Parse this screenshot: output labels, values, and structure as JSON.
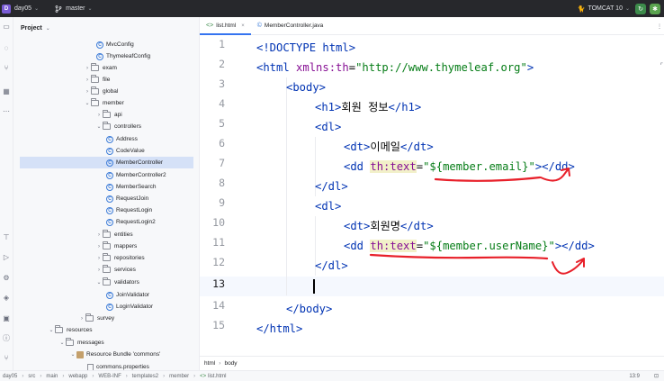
{
  "titlebar": {
    "project_badge": "D",
    "project_name": "day05",
    "branch": "master",
    "run_config": "TOMCAT 10",
    "colors": {
      "background": "#27282c",
      "badge": "#7a5cd6",
      "run": "#3d8b4b"
    }
  },
  "project_panel": {
    "title": "Project",
    "tree": [
      {
        "label": "MvcConfig",
        "kind": "class"
      },
      {
        "label": "ThymeleafConfig",
        "kind": "class"
      },
      {
        "label": "exam",
        "kind": "folder"
      },
      {
        "label": "file",
        "kind": "folder"
      },
      {
        "label": "global",
        "kind": "folder"
      },
      {
        "label": "member",
        "kind": "folder"
      },
      {
        "label": "api",
        "kind": "folder"
      },
      {
        "label": "controllers",
        "kind": "folder"
      },
      {
        "label": "Address",
        "kind": "class"
      },
      {
        "label": "CodeValue",
        "kind": "class"
      },
      {
        "label": "MemberController",
        "kind": "class",
        "selected": true
      },
      {
        "label": "MemberController2",
        "kind": "class"
      },
      {
        "label": "MemberSearch",
        "kind": "class"
      },
      {
        "label": "RequestJoin",
        "kind": "class"
      },
      {
        "label": "RequestLogin",
        "kind": "class"
      },
      {
        "label": "RequestLogin2",
        "kind": "class"
      },
      {
        "label": "entities",
        "kind": "folder"
      },
      {
        "label": "mappers",
        "kind": "folder"
      },
      {
        "label": "repositories",
        "kind": "folder"
      },
      {
        "label": "services",
        "kind": "folder"
      },
      {
        "label": "validators",
        "kind": "folder"
      },
      {
        "label": "JoinValidator",
        "kind": "class"
      },
      {
        "label": "LoginValidator",
        "kind": "class"
      },
      {
        "label": "survey",
        "kind": "folder"
      },
      {
        "label": "resources",
        "kind": "folder"
      },
      {
        "label": "messages",
        "kind": "folder"
      },
      {
        "label": "Resource Bundle 'commons'",
        "kind": "bundle"
      },
      {
        "label": "commons.properties",
        "kind": "props"
      }
    ]
  },
  "editor": {
    "tabs": [
      {
        "label": "list.html",
        "active": true
      },
      {
        "label": "MemberController.java",
        "active": false
      }
    ],
    "line_numbers": [
      "1",
      "2",
      "3",
      "4",
      "5",
      "6",
      "7",
      "8",
      "9",
      "10",
      "11",
      "12",
      "13",
      "14",
      "15"
    ],
    "current_line": "13",
    "code": {
      "l1": "<!DOCTYPE html>",
      "l2_tag_open": "<html ",
      "l2_ns": "xmlns:th",
      "l2_eq": "=",
      "l2_str": "\"http://www.thymeleaf.org\"",
      "l2_close": ">",
      "l3": "<body>",
      "l4_open": "<h1>",
      "l4_text": "회원 정보",
      "l4_close": "</h1>",
      "l5": "<dl>",
      "l6_open": "<dt>",
      "l6_text": "이메일",
      "l6_close": "</dt>",
      "l7_open": "<dd ",
      "l7_attr": "th:text",
      "l7_eq": "=",
      "l7_str": "\"${member.email}\"",
      "l7_close": "></dd>",
      "l8": "</dl>",
      "l9": "<dl>",
      "l10_open": "<dt>",
      "l10_text": "회원명",
      "l10_close": "</dt>",
      "l11_open": "<dd ",
      "l11_attr": "th:text",
      "l11_eq": "=",
      "l11_str": "\"${member.userName}\"",
      "l11_close": "></dd>",
      "l12": "</dl>",
      "l14": "</body>",
      "l15": "</html>"
    },
    "breadcrumbs": [
      "html",
      "body"
    ],
    "annotation_color": "#e8202a"
  },
  "statusbar": {
    "path": [
      "day05",
      "src",
      "main",
      "webapp",
      "WEB-INF",
      "templates2",
      "member",
      "list.html"
    ],
    "cursor_position": "13:9"
  }
}
